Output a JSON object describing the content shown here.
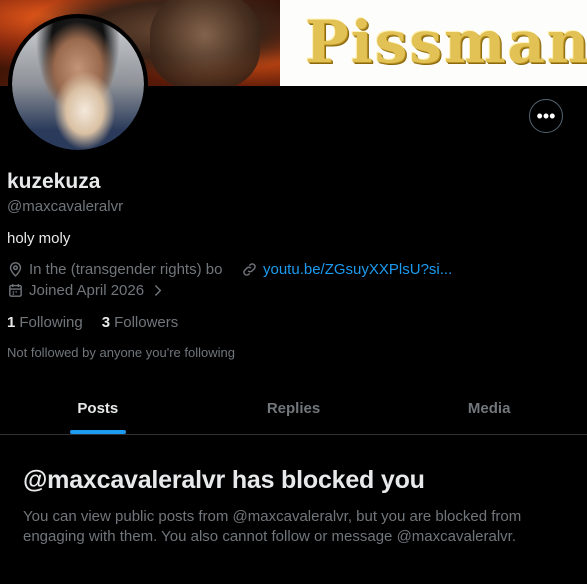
{
  "banner": {
    "text": "Pissman"
  },
  "profile": {
    "display_name": "kuzekuza",
    "handle": "@maxcavaleralvr",
    "bio": "holy moly",
    "location": "In the (transgender rights) bo",
    "link": "youtu.be/ZGsuyXXPlsU?si...",
    "joined": "Joined April 2026",
    "following_count": "1",
    "following_label": "Following",
    "followers_count": "3",
    "followers_label": "Followers",
    "not_followed": "Not followed by anyone you're following"
  },
  "more_button": {
    "glyph": "•••"
  },
  "tabs": [
    {
      "label": "Posts",
      "active": true
    },
    {
      "label": "Replies",
      "active": false
    },
    {
      "label": "Media",
      "active": false
    }
  ],
  "blocked": {
    "title": "@maxcavaleralvr has blocked you",
    "message": "You can view public posts from @maxcavaleralvr, but you are blocked from engaging with them. You also cannot follow or message @maxcavaleralvr."
  },
  "colors": {
    "accent": "#1d9bf0",
    "muted": "#71767b",
    "text": "#e7e9ea",
    "background": "#000000"
  },
  "icons": [
    "location-icon",
    "link-icon",
    "calendar-icon",
    "chevron-right-icon",
    "more-icon"
  ]
}
